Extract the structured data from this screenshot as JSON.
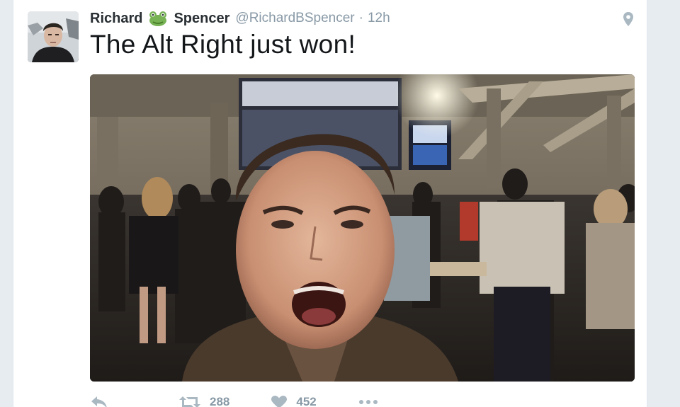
{
  "tweet": {
    "author_first": "Richard",
    "author_last": "Spencer",
    "handle": "@RichardBSpencer",
    "separator": "·",
    "time": "12h",
    "text": "The Alt Right just won!",
    "retweet_count": "288",
    "like_count": "452"
  },
  "icons": {
    "name_emoji": "frog-icon",
    "location": "location-pin-icon",
    "reply": "reply-icon",
    "retweet": "retweet-icon",
    "like": "heart-icon",
    "more": "more-dots-icon"
  },
  "colors": {
    "text_primary": "#14171a",
    "text_secondary": "#8899a6",
    "page_background": "#e6ecf0"
  }
}
